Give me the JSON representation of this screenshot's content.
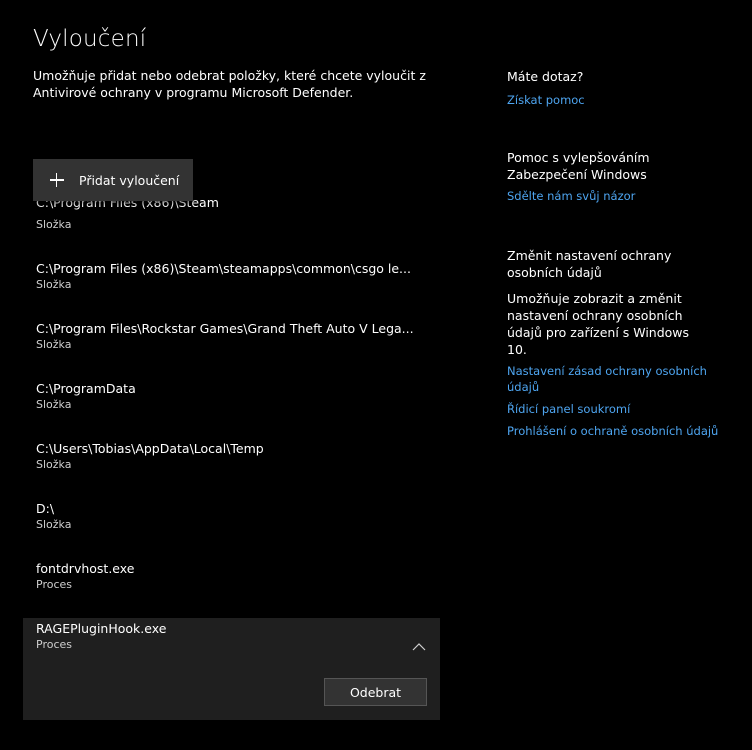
{
  "header": {
    "title": "Vyloučení",
    "description": "Umožňuje přidat nebo odebrat položky, které chcete vyloučit z Antivirové ochrany v programu Microsoft Defender."
  },
  "add_button": {
    "label": "Přidat vyloučení",
    "icon": "plus-icon"
  },
  "exclusions": [
    {
      "path": "C:\\Program Files (x86)\\Steam",
      "type": "Složka"
    },
    {
      "path": "C:\\Program Files (x86)\\Steam\\steamapps\\common\\csgo le...",
      "type": "Složka"
    },
    {
      "path": "C:\\Program Files\\Rockstar Games\\Grand Theft Auto V Lega...",
      "type": "Složka"
    },
    {
      "path": "C:\\ProgramData",
      "type": "Složka"
    },
    {
      "path": "C:\\Users\\Tobias\\AppData\\Local\\Temp",
      "type": "Složka"
    },
    {
      "path": "D:\\",
      "type": "Složka"
    },
    {
      "path": "fontdrvhost.exe",
      "type": "Proces"
    },
    {
      "path": "RAGEPluginHook.exe",
      "type": "Proces",
      "remove_label": "Odebrat"
    }
  ],
  "sidebar": {
    "help": {
      "heading": "Máte dotaz?",
      "link": "Získat pomoc"
    },
    "feedback": {
      "heading": "Pomoc s vylepšováním Zabezpečení Windows",
      "link": "Sdělte nám svůj názor"
    },
    "privacy": {
      "heading": "Změnit nastavení ochrany osobních údajů",
      "text": "Umožňuje zobrazit a změnit nastavení ochrany osobních údajů pro zařízení s Windows 10.",
      "links": [
        "Nastavení zásad ochrany osobních údajů",
        "Řídicí panel soukromí",
        "Prohlášení o ochraně osobních údajů"
      ]
    }
  },
  "colors": {
    "background": "#000000",
    "accent_link": "#4ea5f0",
    "button": "#333333",
    "expanded_row": "#1f1f1f"
  }
}
